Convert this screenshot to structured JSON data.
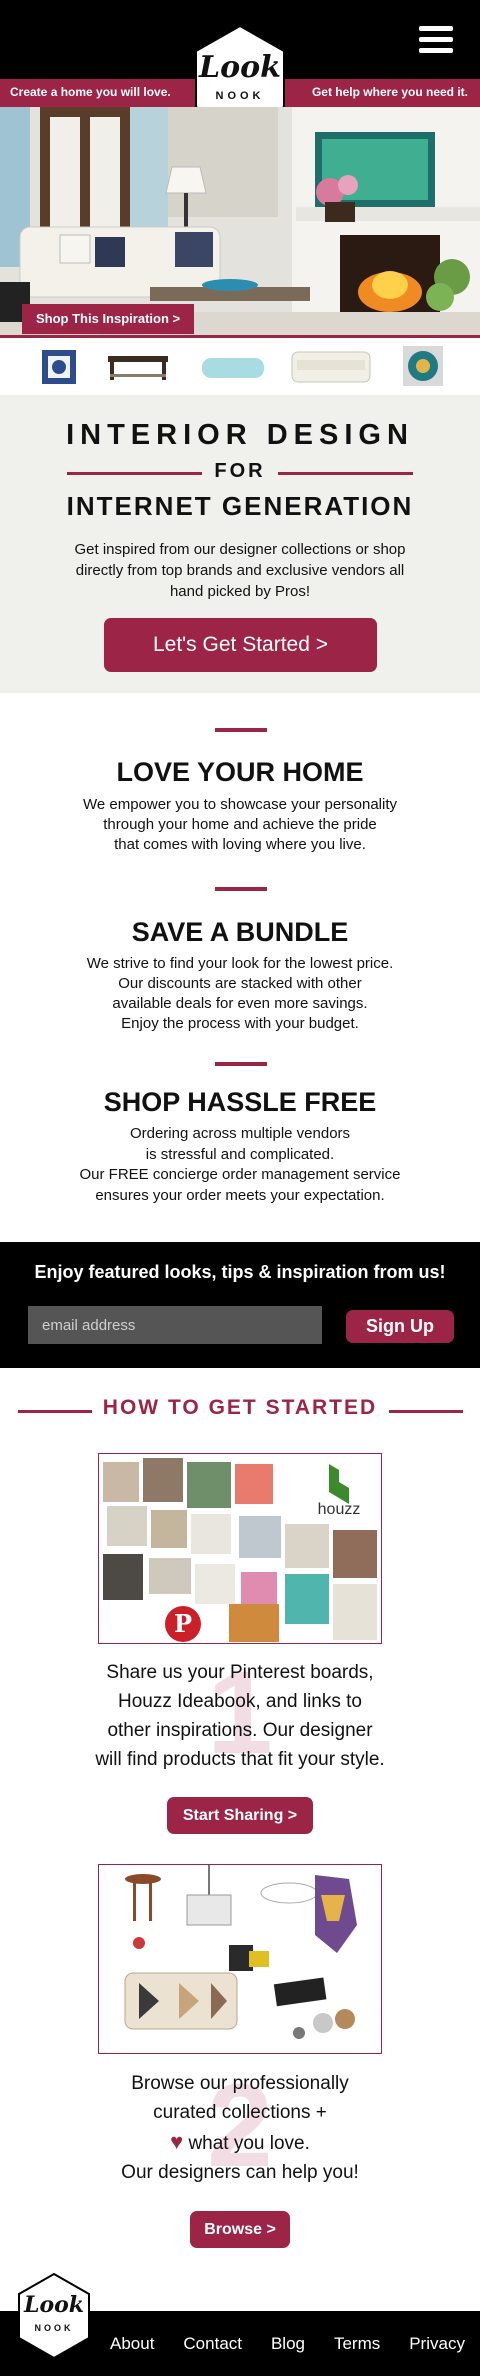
{
  "header": {
    "tagline_left": "Create a home you will love.",
    "tagline_right": "Get help where you need it.",
    "logo_script": "Look",
    "logo_caps": "NOOK",
    "menu_icon": "hamburger-menu-icon"
  },
  "hero": {
    "shop_button": "Shop This Inspiration >"
  },
  "products": [
    "pillow",
    "coffee-table",
    "bolster-pillow",
    "sofa",
    "decor-plate"
  ],
  "intro": {
    "line1": "INTERIOR DESIGN",
    "line2": "FOR",
    "line3": "INTERNET GENERATION",
    "description": "Get inspired from our designer collections or shop directly from top brands and exclusive vendors all hand picked by Pros!",
    "cta": "Let's Get Started >"
  },
  "features": [
    {
      "title": "LOVE YOUR HOME",
      "lines": [
        "We empower you to showcase your personality",
        "through your home and achieve the pride",
        "that comes with loving where you live."
      ]
    },
    {
      "title": "SAVE A BUNDLE",
      "lines": [
        "We strive to find your look for the lowest price.",
        "Our discounts are stacked with other",
        "available deals for  even more savings.",
        "Enjoy the process with your budget."
      ]
    },
    {
      "title": "SHOP HASSLE FREE",
      "lines": [
        "Ordering across multiple vendors",
        "is stressful and complicated.",
        "Our FREE concierge order management service",
        "ensures your order  meets your expectation."
      ]
    }
  ],
  "newsletter": {
    "title": "Enjoy featured looks, tips & inspiration from us!",
    "placeholder": "email address",
    "button": "Sign Up"
  },
  "how": {
    "title": "HOW TO GET STARTED",
    "steps": [
      {
        "number": "1",
        "lines": [
          "Share us your Pinterest boards,",
          "Houzz Ideabook, and links to",
          "other inspirations. Our designer",
          "will find products that fit your style."
        ],
        "button": "Start Sharing >"
      },
      {
        "number": "2",
        "lines": [
          "Browse our professionally",
          "curated collections +",
          "what you love.",
          "Our designers can help you!"
        ],
        "button": "Browse >"
      }
    ],
    "houzz_label": "houzz"
  },
  "footer": {
    "links": [
      "About",
      "Contact",
      "Blog",
      "Terms",
      "Privacy"
    ]
  },
  "colors": {
    "brand": "#9b2447",
    "black": "#000000",
    "light_bg": "#f0f0ec"
  }
}
